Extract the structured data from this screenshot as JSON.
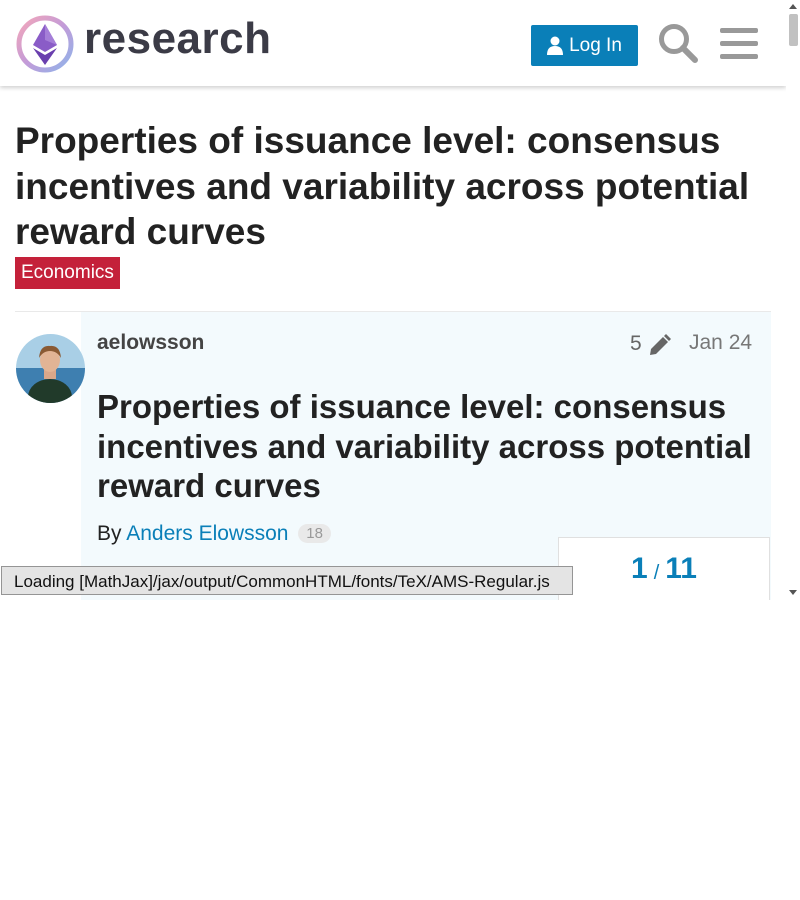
{
  "header": {
    "site_name": "research",
    "login_label": "Log In"
  },
  "topic": {
    "title": "Properties of issuance level: consensus incentives and variability across potential reward curves",
    "category": "Economics"
  },
  "post": {
    "username": "aelowsson",
    "edit_count": "5",
    "date": "Jan 24",
    "heading": "Properties of issuance level: consensus incentives and variability across potential reward curves",
    "byline_prefix": "By",
    "author_link": "Anders Elowsson",
    "link_clicks": "18"
  },
  "progress": {
    "current": "1",
    "separator": "/",
    "total": "11"
  },
  "status_message": "Loading [MathJax]/jax/output/CommonHTML/fonts/TeX/AMS-Regular.js",
  "icons": [
    "logo-icon",
    "user-icon",
    "search-icon",
    "menu-icon",
    "pencil-icon"
  ],
  "colors": {
    "primary": "#0a7fb8",
    "category": "#c4213a",
    "post_background": "#f3fafd"
  }
}
